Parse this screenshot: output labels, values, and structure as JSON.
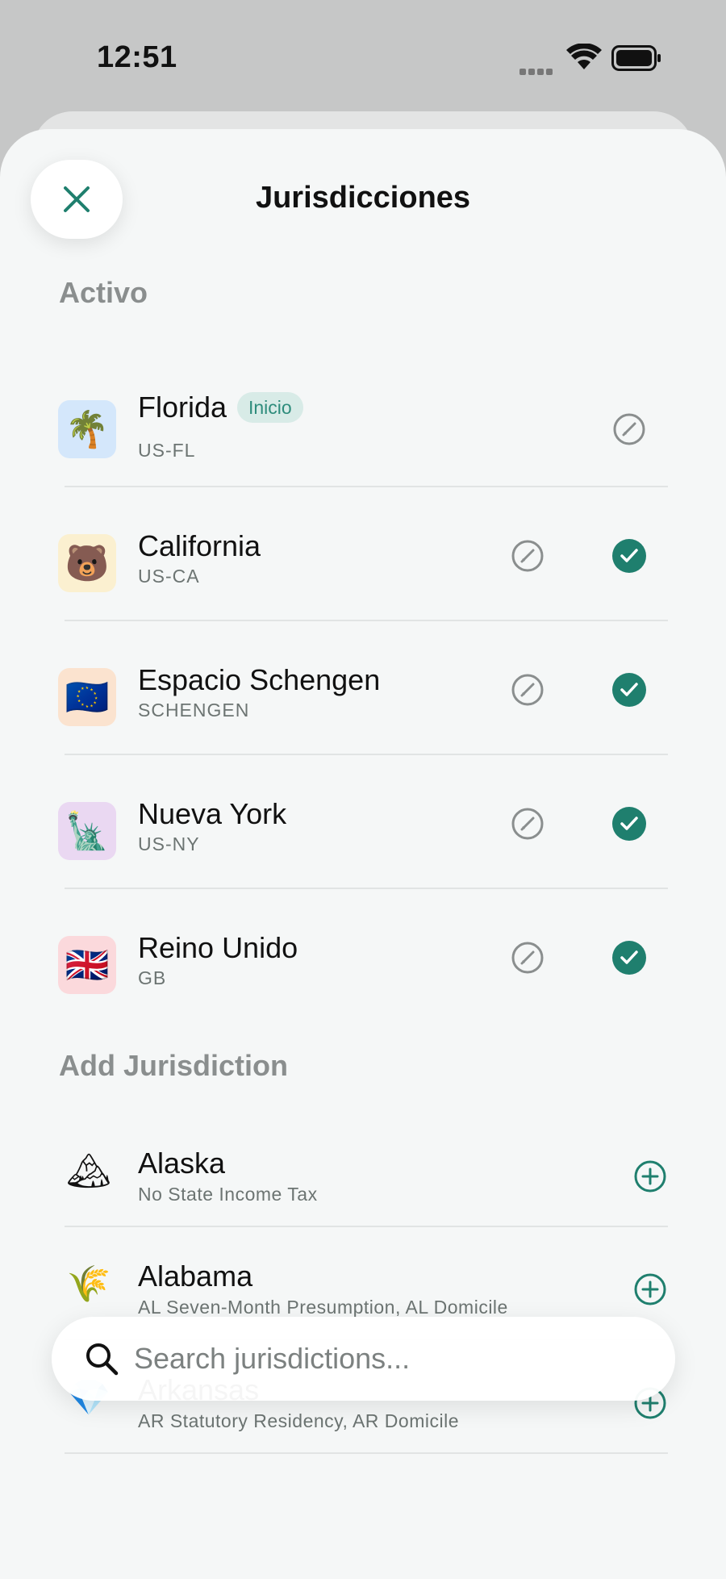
{
  "status_bar": {
    "time": "12:51"
  },
  "header": {
    "title": "Jurisdicciones"
  },
  "sections": {
    "active_title": "Activo",
    "add_title": "Add Jurisdiction"
  },
  "active": [
    {
      "name": "Florida",
      "code": "US-FL",
      "icon": "🌴",
      "icon_name": "palm-tree-icon",
      "tile_color": "#d4e7fb",
      "badge": "Inicio",
      "checked": false
    },
    {
      "name": "California",
      "code": "US-CA",
      "icon": "🐻",
      "icon_name": "bear-icon",
      "tile_color": "#fbf0d0",
      "checked": true
    },
    {
      "name": "Espacio Schengen",
      "code": "SCHENGEN",
      "icon": "🇪🇺",
      "icon_name": "eu-flag-icon",
      "tile_color": "#fbe3cf",
      "checked": true
    },
    {
      "name": "Nueva York",
      "code": "US-NY",
      "icon": "🗽",
      "icon_name": "statue-of-liberty-icon",
      "tile_color": "#ead8f2",
      "checked": true
    },
    {
      "name": "Reino Unido",
      "code": "GB",
      "icon": "🇬🇧",
      "icon_name": "uk-flag-icon",
      "tile_color": "#fbd9dc",
      "checked": true
    }
  ],
  "add_list": [
    {
      "name": "Alaska",
      "desc": "No State Income Tax",
      "icon": "🏔",
      "icon_name": "mountain-icon"
    },
    {
      "name": "Alabama",
      "desc": "AL Seven-Month Presumption, AL Domicile",
      "icon": "🌾",
      "icon_name": "wheat-icon"
    },
    {
      "name": "Arkansas",
      "desc": "AR Statutory Residency, AR Domicile",
      "icon": "💎",
      "icon_name": "diamond-icon"
    }
  ],
  "search": {
    "placeholder": "Search jurisdictions..."
  },
  "colors": {
    "accent": "#1f7f6e",
    "badge_bg": "#d8ebe7",
    "section_gray": "#8a8e8e"
  }
}
